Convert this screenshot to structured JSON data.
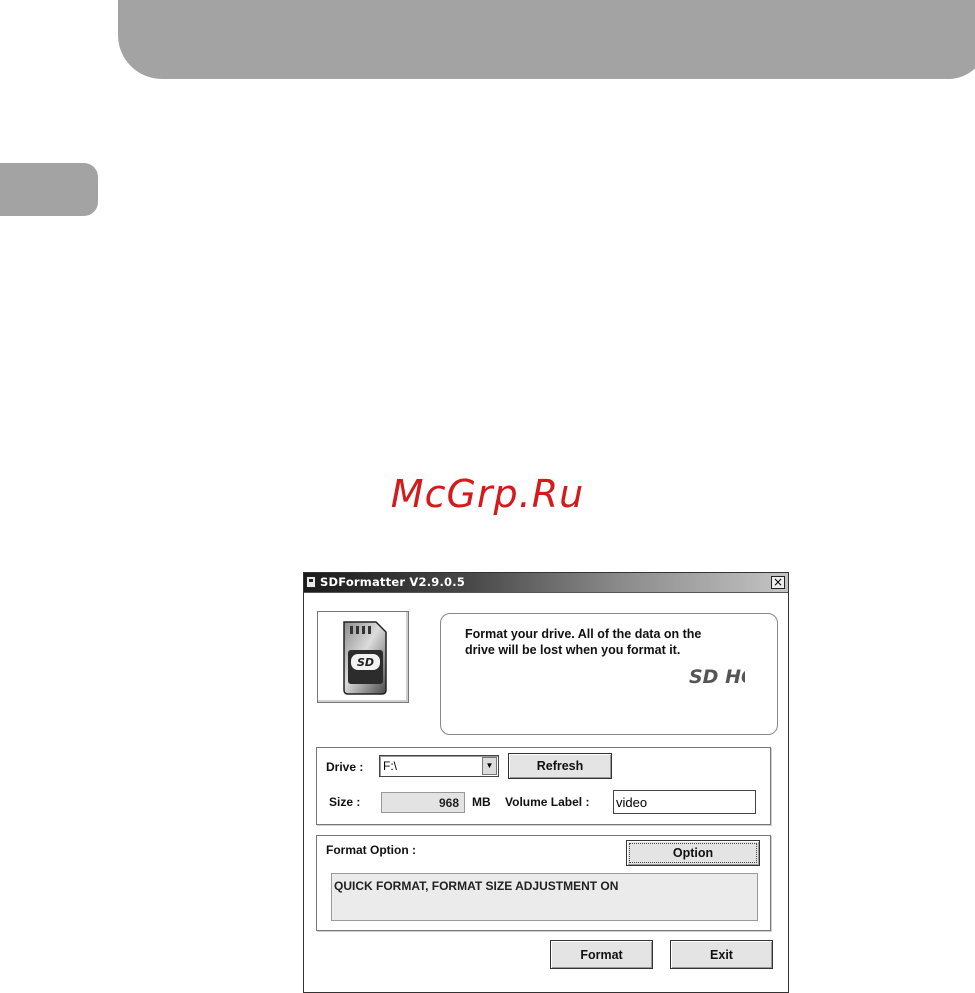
{
  "watermark": "McGrp.Ru",
  "window": {
    "title": "SDFormatter V2.9.0.5",
    "close_glyph": "×",
    "icon": "app-window-icon"
  },
  "card_image": {
    "icon": "sd-card-icon",
    "card_text": "SD"
  },
  "info": {
    "message": "Format your drive. All of the data on the drive will be lost when you format it.",
    "logo": "sdhc-logo",
    "logo_text": "SD HC"
  },
  "drive_section": {
    "drive_label": "Drive :",
    "drive_value": "F:\\",
    "dropdown_glyph": "▼",
    "refresh_label": "Refresh",
    "size_label": "Size  :",
    "size_value": "968",
    "size_unit": "MB",
    "volume_label": "Volume Label  :",
    "volume_value": "video"
  },
  "format_option": {
    "label": "Format Option :",
    "option_button": "Option",
    "current": "QUICK FORMAT, FORMAT SIZE ADJUSTMENT ON"
  },
  "actions": {
    "format_label": "Format",
    "exit_label": "Exit"
  },
  "colors": {
    "band_gray": "#a3a3a3",
    "watermark_red": "#d41a1a",
    "button_face": "#e4e4e4"
  }
}
